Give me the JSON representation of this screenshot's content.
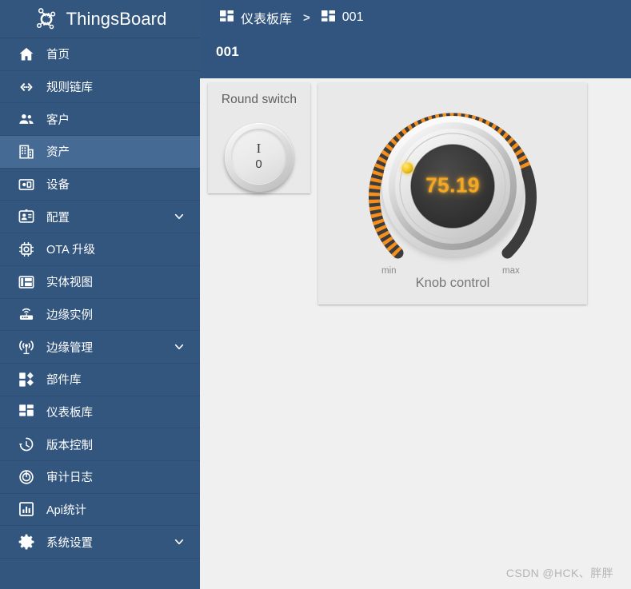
{
  "brand": {
    "name": "ThingsBoard",
    "logo_icon": "thingsboard-logo-icon"
  },
  "sidebar": {
    "items": [
      {
        "label": "首页",
        "icon": "home-icon",
        "active": false,
        "expandable": false
      },
      {
        "label": "规则链库",
        "icon": "rule-chain-icon",
        "active": false,
        "expandable": false
      },
      {
        "label": "客户",
        "icon": "customers-icon",
        "active": false,
        "expandable": false
      },
      {
        "label": "资产",
        "icon": "assets-icon",
        "active": true,
        "expandable": false
      },
      {
        "label": "设备",
        "icon": "devices-icon",
        "active": false,
        "expandable": false
      },
      {
        "label": "配置",
        "icon": "profiles-icon",
        "active": false,
        "expandable": true
      },
      {
        "label": "OTA 升级",
        "icon": "ota-update-icon",
        "active": false,
        "expandable": false
      },
      {
        "label": "实体视图",
        "icon": "entity-view-icon",
        "active": false,
        "expandable": false
      },
      {
        "label": "边缘实例",
        "icon": "edge-instance-icon",
        "active": false,
        "expandable": false
      },
      {
        "label": "边缘管理",
        "icon": "edge-management-icon",
        "active": false,
        "expandable": true
      },
      {
        "label": "部件库",
        "icon": "widget-library-icon",
        "active": false,
        "expandable": false
      },
      {
        "label": "仪表板库",
        "icon": "dashboard-library-icon",
        "active": false,
        "expandable": false
      },
      {
        "label": "版本控制",
        "icon": "version-control-icon",
        "active": false,
        "expandable": false
      },
      {
        "label": "审计日志",
        "icon": "audit-log-icon",
        "active": false,
        "expandable": false
      },
      {
        "label": "Api统计",
        "icon": "api-usage-icon",
        "active": false,
        "expandable": false
      },
      {
        "label": "系统设置",
        "icon": "system-settings-icon",
        "active": false,
        "expandable": true
      }
    ]
  },
  "header": {
    "breadcrumb": [
      {
        "label": "仪表板库",
        "icon": "dashboard-library-icon"
      },
      {
        "label": "001",
        "icon": "dashboard-library-icon"
      }
    ],
    "separator": ">",
    "page_title": "001"
  },
  "dashboard": {
    "widgets": {
      "round_switch": {
        "title": "Round switch",
        "mark_on": "I",
        "mark_off": "0",
        "state": "off"
      },
      "knob_control": {
        "caption": "Knob control",
        "value": "75.19",
        "min_label": "min",
        "max_label": "max",
        "percent": 75.19,
        "value_color": "#f5a623",
        "track_color": "#3c3c3c"
      }
    }
  },
  "watermark": "CSDN @HCK、胖胖",
  "colors": {
    "sidebar_bg": "#33567f",
    "sidebar_active": "#456a93",
    "header_bg": "#31557f",
    "canvas_bg": "#f0f0f0",
    "widget_bg": "#e9e9e9",
    "accent_orange": "#f5a623"
  }
}
